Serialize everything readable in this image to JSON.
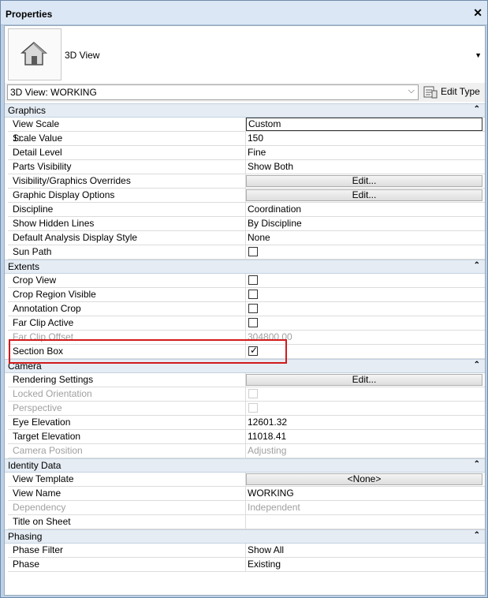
{
  "window": {
    "title": "Properties"
  },
  "type_selector": {
    "type_name": "3D View"
  },
  "instance_selector": {
    "value": "3D View: WORKING",
    "edit_type_label": "Edit Type"
  },
  "groups": [
    {
      "name": "Graphics",
      "rows": [
        {
          "name": "View Scale",
          "value": "Custom",
          "kind": "boxed"
        },
        {
          "name": "Scale Value",
          "name_suffix": "1:",
          "value": "150",
          "kind": "text"
        },
        {
          "name": "Detail Level",
          "value": "Fine",
          "kind": "text"
        },
        {
          "name": "Parts Visibility",
          "value": "Show Both",
          "kind": "text"
        },
        {
          "name": "Visibility/Graphics Overrides",
          "value": "Edit...",
          "kind": "button"
        },
        {
          "name": "Graphic Display Options",
          "value": "Edit...",
          "kind": "button"
        },
        {
          "name": "Discipline",
          "value": "Coordination",
          "kind": "text"
        },
        {
          "name": "Show Hidden Lines",
          "value": "By Discipline",
          "kind": "text"
        },
        {
          "name": "Default Analysis Display Style",
          "value": "None",
          "kind": "text"
        },
        {
          "name": "Sun Path",
          "value": "",
          "kind": "checkbox",
          "checked": false
        }
      ]
    },
    {
      "name": "Extents",
      "rows": [
        {
          "name": "Crop View",
          "value": "",
          "kind": "checkbox",
          "checked": false
        },
        {
          "name": "Crop Region Visible",
          "value": "",
          "kind": "checkbox",
          "checked": false
        },
        {
          "name": "Annotation Crop",
          "value": "",
          "kind": "checkbox",
          "checked": false
        },
        {
          "name": "Far Clip Active",
          "value": "",
          "kind": "checkbox",
          "checked": false
        },
        {
          "name": "Far Clip Offset",
          "value": "304800.00",
          "kind": "text",
          "disabled": true
        },
        {
          "name": "Section Box",
          "value": "",
          "kind": "checkbox",
          "checked": true
        }
      ]
    },
    {
      "name": "Camera",
      "rows": [
        {
          "name": "Rendering Settings",
          "value": "Edit...",
          "kind": "button"
        },
        {
          "name": "Locked Orientation",
          "value": "",
          "kind": "checkbox",
          "checked": false,
          "disabled": true
        },
        {
          "name": "Perspective",
          "value": "",
          "kind": "checkbox",
          "checked": false,
          "disabled": true
        },
        {
          "name": "Eye Elevation",
          "value": "12601.32",
          "kind": "text"
        },
        {
          "name": "Target Elevation",
          "value": "11018.41",
          "kind": "text"
        },
        {
          "name": "Camera Position",
          "value": "Adjusting",
          "kind": "text",
          "disabled": true
        }
      ]
    },
    {
      "name": "Identity Data",
      "rows": [
        {
          "name": "View Template",
          "value": "<None>",
          "kind": "button"
        },
        {
          "name": "View Name",
          "value": "WORKING",
          "kind": "text"
        },
        {
          "name": "Dependency",
          "value": "Independent",
          "kind": "text",
          "disabled": true,
          "name_disabled": true
        },
        {
          "name": "Title on Sheet",
          "value": "",
          "kind": "text"
        }
      ]
    },
    {
      "name": "Phasing",
      "rows": [
        {
          "name": "Phase Filter",
          "value": "Show All",
          "kind": "text"
        },
        {
          "name": "Phase",
          "value": "Existing",
          "kind": "text"
        }
      ]
    }
  ],
  "colors": {
    "highlight": "#d21a1a",
    "group_bg": "#e5ecf4",
    "frame": "#bcd1e8"
  },
  "icons": {
    "close": "close-icon",
    "house": "house-icon",
    "collapse": "collapse-up-icon",
    "edit_type": "edit-type-icon"
  }
}
